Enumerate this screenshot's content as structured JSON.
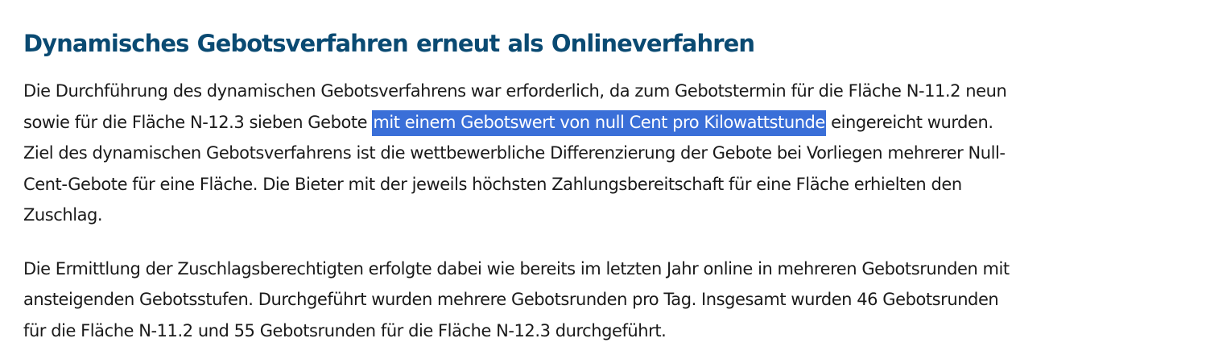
{
  "article": {
    "heading": "Dynamisches Gebotsverfahren erneut als Onlineverfahren",
    "paragraph_1": {
      "line_1": "Die Durchführung des dynamischen Gebotsverfahrens war erforderlich, da zum Gebotstermin für die Fläche N-11.2 neun",
      "line_2_before": "sowie für die Fläche N-12.3 sieben Gebote ",
      "line_2_selected": "mit einem Gebotswert von null Cent pro Kilowattstunde",
      "line_2_after": " eingereicht wurden.",
      "line_3": "Ziel des dynamischen Gebotsverfahrens ist die wettbewerbliche Differenzierung der Gebote bei Vorliegen mehrerer Null-",
      "line_4": "Cent-Gebote für eine Fläche. Die Bieter mit der jeweils höchsten Zahlungsbereitschaft für eine Fläche erhielten den",
      "line_5": "Zuschlag."
    },
    "paragraph_2": {
      "line_1": "Die Ermittlung der Zuschlagsberechtigten erfolgte dabei wie bereits im letzten Jahr online in mehreren Gebotsrunden mit",
      "line_2": "ansteigenden Gebotsstufen. Durchgeführt wurden mehrere Gebotsrunden pro Tag. Insgesamt wurden 46 Gebotsrunden",
      "line_3": "für die Fläche N-11.2 und 55 Gebotsrunden für die Fläche N-12.3 durchgeführt."
    }
  },
  "colors": {
    "heading": "#0a4a72",
    "body_text": "#1a1a1a",
    "selection_background": "#3a6fd8",
    "selection_text": "#ffffff"
  }
}
